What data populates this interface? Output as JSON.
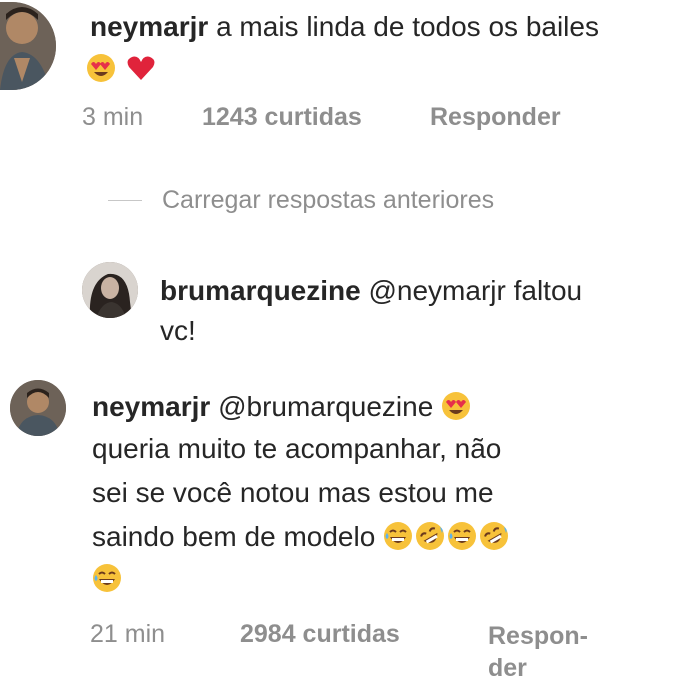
{
  "comment1": {
    "username": "neymarjr",
    "text": "a mais linda de todos os bailes",
    "emojis": [
      "heart-eyes-icon",
      "red-heart-icon"
    ],
    "time": "3 min",
    "likes": "1243 curtidas",
    "reply_label": "Responder"
  },
  "load_replies": "Carregar respostas anteriores",
  "reply1": {
    "username": "brumarquezine",
    "mention": "@neymarjr",
    "text_line1": "faltou",
    "text_line2": "vc!"
  },
  "reply2": {
    "username": "neymarjr",
    "mention": "@brumarquezine",
    "text_line1": "queria muito te  acompanhar, não",
    "text_line2": "sei se você notou mas estou me",
    "text_line3": "saindo bem de modelo",
    "emojis": [
      "heart-eyes-icon",
      "grinning-sweat-icon",
      "rolling-laughing-icon",
      "grinning-sweat-icon",
      "rolling-laughing-icon",
      "grinning-sweat-icon"
    ],
    "time": "21 min",
    "likes": "2984 curtidas",
    "reply_label_line1": "Respon-",
    "reply_label_line2": "der"
  },
  "colors": {
    "text": "#262626",
    "meta": "#8e8e8e",
    "divider": "#c7c7c7",
    "heart": "#ed4956"
  }
}
